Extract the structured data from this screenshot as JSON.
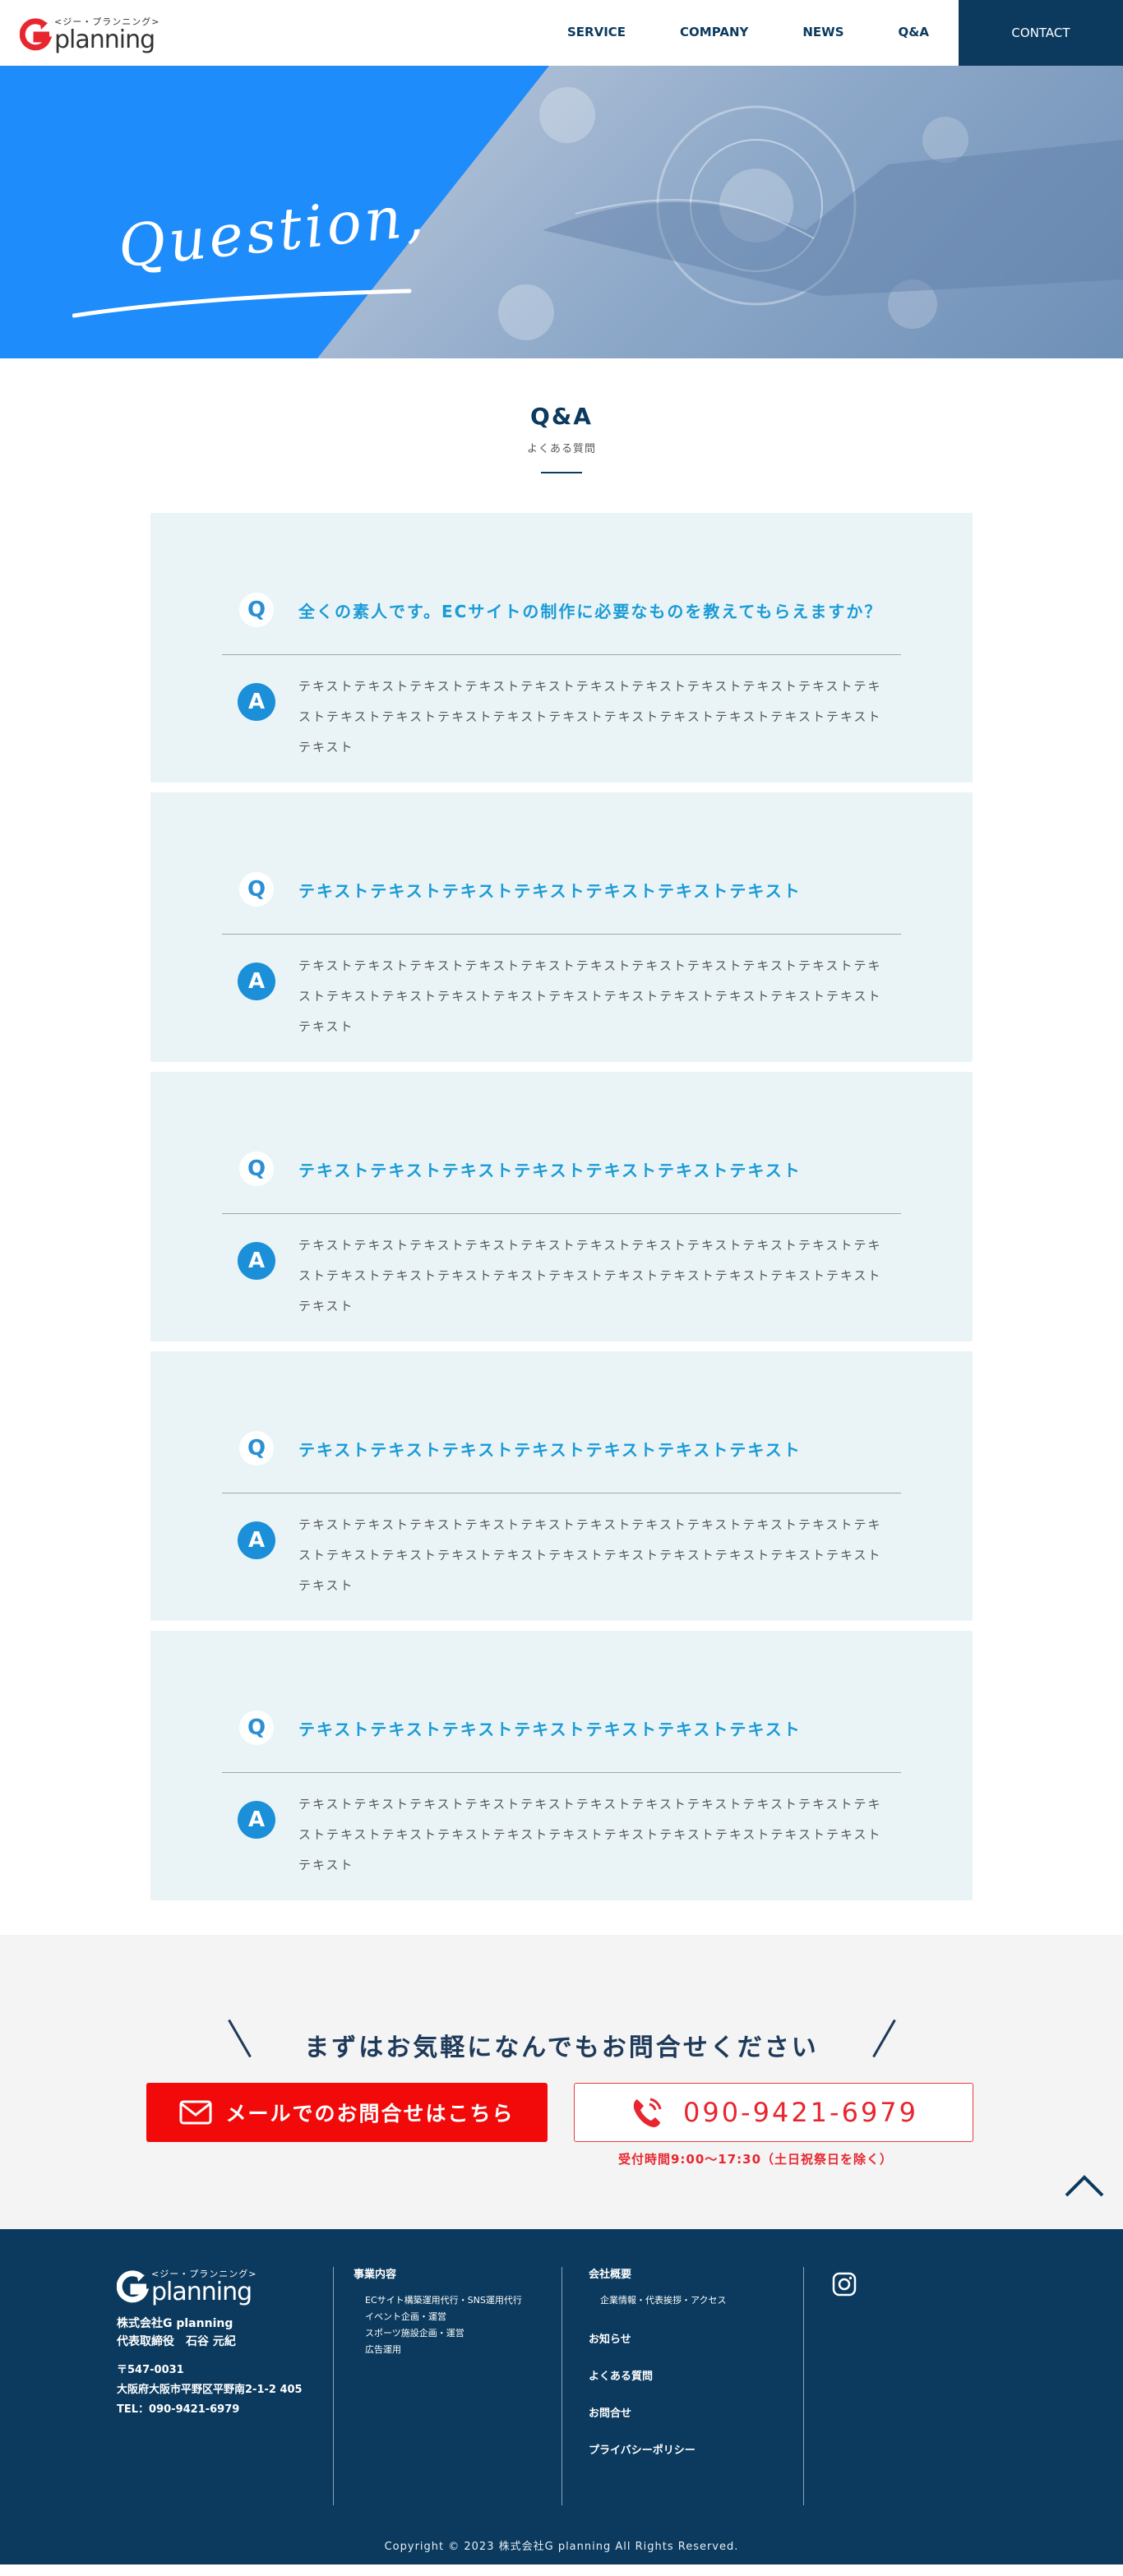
{
  "header": {
    "logo_kana": "<ジー・プランニング>",
    "logo_word": "planning",
    "nav": [
      "SERVICE",
      "COMPANY",
      "NEWS",
      "Q&A"
    ],
    "contact": "CONTACT"
  },
  "hero": {
    "title": "Question,"
  },
  "section": {
    "title": "Q&A",
    "subtitle": "よくある質問"
  },
  "qa": [
    {
      "q_badge": "Q",
      "question": "全くの素人です。ECサイトの制作に必要なものを教えてもらえますか？",
      "a_badge": "A",
      "answer": "テキストテキストテキストテキストテキストテキストテキストテキストテキストテキストテキストテキストテキストテキストテキストテキストテキストテキストテキストテキストテキストテキスト"
    },
    {
      "q_badge": "Q",
      "question": "テキストテキストテキストテキストテキストテキストテキスト",
      "a_badge": "A",
      "answer": "テキストテキストテキストテキストテキストテキストテキストテキストテキストテキストテキストテキストテキストテキストテキストテキストテキストテキストテキストテキストテキストテキスト"
    },
    {
      "q_badge": "Q",
      "question": "テキストテキストテキストテキストテキストテキストテキスト",
      "a_badge": "A",
      "answer": "テキストテキストテキストテキストテキストテキストテキストテキストテキストテキストテキストテキストテキストテキストテキストテキストテキストテキストテキストテキストテキストテキスト"
    },
    {
      "q_badge": "Q",
      "question": "テキストテキストテキストテキストテキストテキストテキスト",
      "a_badge": "A",
      "answer": "テキストテキストテキストテキストテキストテキストテキストテキストテキストテキストテキストテキストテキストテキストテキストテキストテキストテキストテキストテキストテキストテキスト"
    },
    {
      "q_badge": "Q",
      "question": "テキストテキストテキストテキストテキストテキストテキスト",
      "a_badge": "A",
      "answer": "テキストテキストテキストテキストテキストテキストテキストテキストテキストテキストテキストテキストテキストテキストテキストテキストテキストテキストテキストテキストテキストテキスト"
    }
  ],
  "contact": {
    "title": "まずはお気軽になんでもお問合せください",
    "mail_label": "メールでのお問合せはこちら",
    "tel": "090-9421-6979",
    "hours": "受付時間9:00～17:30（土日祝祭日を除く）"
  },
  "footer": {
    "logo_kana": "<ジー・プランニング>",
    "logo_word": "planning",
    "company": "株式会社G planning",
    "rep": "代表取締役　石谷 元紀",
    "zip": "〒547-0031",
    "address": "大阪府大阪市平野区平野南2-1-2 405",
    "tel": "TEL：090-9421-6979",
    "business_title": "事業内容",
    "business_items": [
      "ECサイト構築運用代行・SNS運用代行",
      "イベント企画・運営",
      "スポーツ施設企画・運営",
      "広告運用"
    ],
    "company_title": "会社概要",
    "company_sub": "企業情報・代表挨拶・アクセス",
    "links": [
      "お知らせ",
      "よくある質問",
      "お問合せ",
      "プライバシーポリシー"
    ],
    "copyright": "Copyright © 2023 株式会社G planning All Rights Reserved."
  },
  "colors": {
    "navy": "#0b3a5e",
    "blue": "#1e8cfb",
    "red": "#f20a0a",
    "card": "#eaf4f7"
  }
}
